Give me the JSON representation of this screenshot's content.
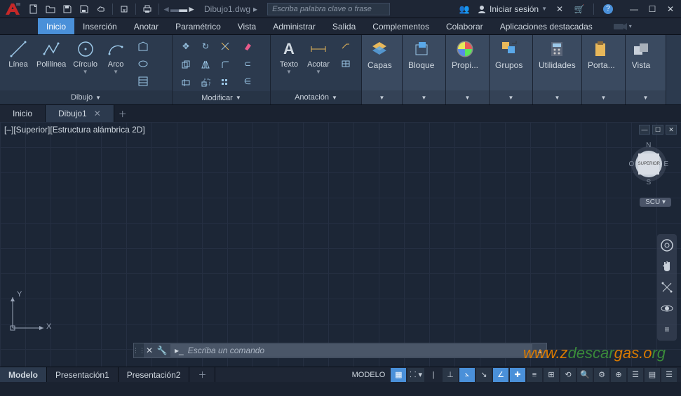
{
  "title": {
    "filename": "Dibujo1.dwg",
    "search_placeholder": "Escriba palabra clave o frase",
    "signin": "Iniciar sesión"
  },
  "menu": {
    "tabs": [
      "Inicio",
      "Inserción",
      "Anotar",
      "Paramétrico",
      "Vista",
      "Administrar",
      "Salida",
      "Complementos",
      "Colaborar",
      "Aplicaciones destacadas"
    ]
  },
  "ribbon": {
    "draw": {
      "title": "Dibujo",
      "linea": "Línea",
      "polilinea": "Polilínea",
      "circulo": "Círculo",
      "arco": "Arco"
    },
    "modify": {
      "title": "Modificar"
    },
    "annot": {
      "title": "Anotación",
      "texto": "Texto",
      "acotar": "Acotar"
    },
    "layers": {
      "title": "Capas"
    },
    "block": {
      "title": "Bloque"
    },
    "props": {
      "title": "Propi..."
    },
    "groups": {
      "title": "Grupos"
    },
    "utils": {
      "title": "Utilidades"
    },
    "clip": {
      "title": "Porta..."
    },
    "view": {
      "title": "Vista"
    }
  },
  "filetabs": {
    "home": "Inicio",
    "doc": "Dibujo1"
  },
  "viewport": {
    "label": "[–][Superior][Estructura alámbrica 2D]",
    "compass": {
      "n": "N",
      "s": "S",
      "e": "E",
      "w": "O",
      "face": "SUPERIOR"
    },
    "scu": "SCU",
    "ucs": {
      "x": "X",
      "y": "Y"
    }
  },
  "cmd": {
    "placeholder": "Escriba un comando"
  },
  "bottom": {
    "model": "Modelo",
    "p1": "Presentación1",
    "p2": "Presentación2",
    "modelo_btn": "MODELO"
  },
  "watermark": {
    "a": "www.z",
    "b": "descar",
    "c": "gas.o",
    "d": "rg"
  }
}
